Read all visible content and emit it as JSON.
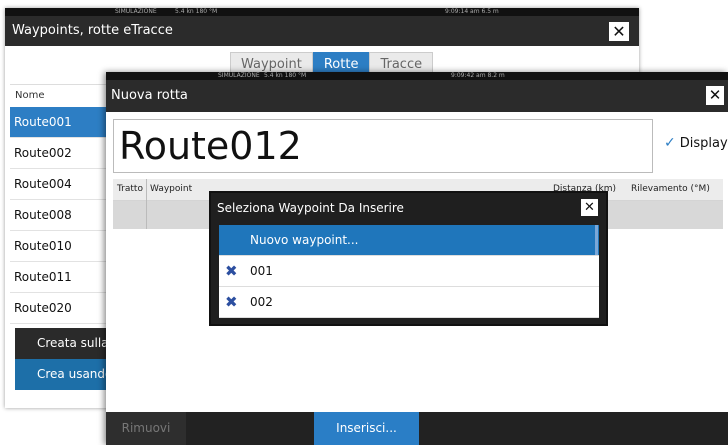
{
  "back_window": {
    "status": {
      "sim": "SIMULAZIONE",
      "speed": "5.4 kn 180 °M",
      "time": "9:09:14 am  6.5 m"
    },
    "title": "Waypoints, rotte eTracce",
    "close_label": "✕",
    "tabs": [
      {
        "label": "Waypoint"
      },
      {
        "label": "Rotte"
      },
      {
        "label": "Tracce"
      }
    ],
    "list_header": "Nome",
    "routes": [
      "Route001",
      "Route002",
      "Route004",
      "Route008",
      "Route010",
      "Route011",
      "Route020"
    ],
    "create_menu": [
      {
        "label": "Creata sulla carta"
      },
      {
        "label": "Crea usando"
      }
    ]
  },
  "front_window": {
    "status": {
      "sim": "SIMULAZIONE",
      "speed": "5.4 kn 180 °M",
      "time": "9:09:42 am  8.2 m"
    },
    "title": "Nuova rotta",
    "close_label": "✕",
    "route_name": "Route012",
    "display_label": "Display",
    "table_headers": {
      "leg": "Tratto",
      "waypoint": "Waypoint",
      "distance": "Distanza (km)",
      "bearing": "Rilevamento (°M)"
    },
    "buttons": {
      "remove": "Rimuovi",
      "insert": "Inserisci..."
    }
  },
  "dialog": {
    "title": "Seleziona Waypoint Da Inserire",
    "close_label": "✕",
    "items": [
      {
        "label": "Nuovo waypoint...",
        "icon": ""
      },
      {
        "label": "001",
        "icon": "waypoint-icon"
      },
      {
        "label": "002",
        "icon": "waypoint-icon"
      }
    ]
  },
  "colors": {
    "accent": "#2d7ec4",
    "titlebar": "#2b2b2b",
    "dialog_bg": "#1f1f1f",
    "waypoint_icon": "#2c4fa0"
  }
}
